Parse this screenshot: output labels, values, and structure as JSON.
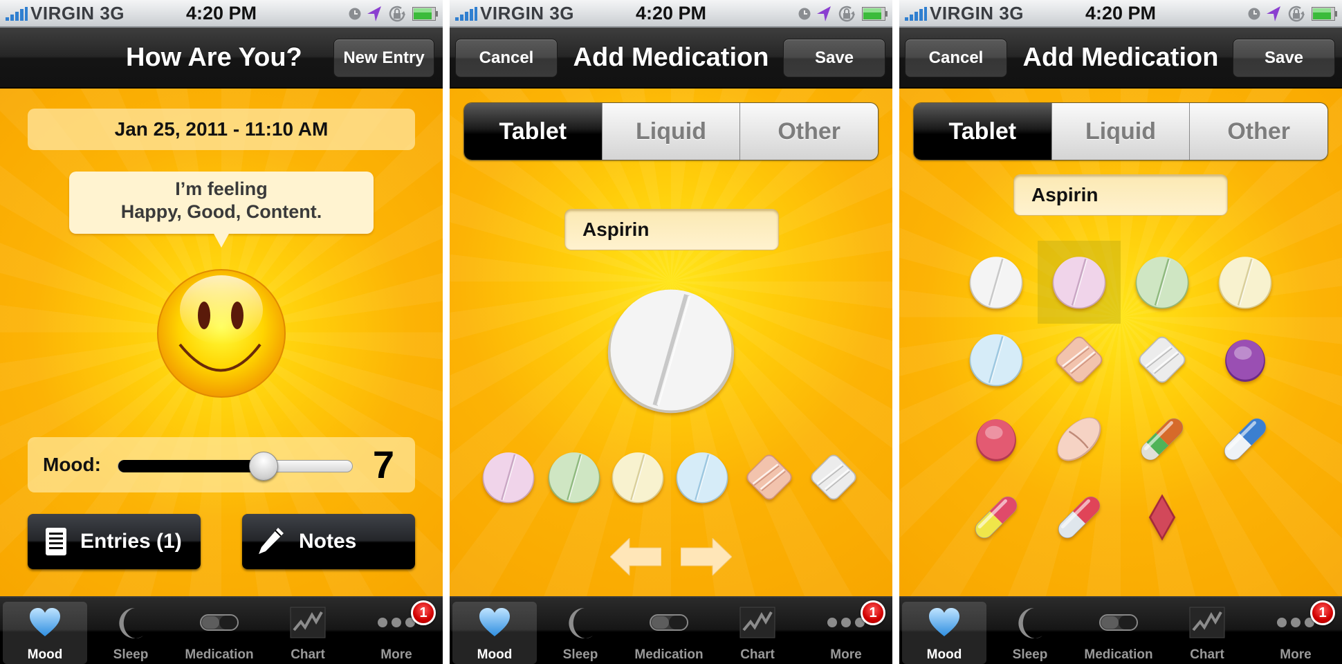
{
  "status_bar": {
    "carrier": "VIRGIN",
    "network": "3G",
    "time": "4:20 PM",
    "icons": [
      "signal-bars-icon",
      "alarm-clock-icon",
      "location-arrow-icon",
      "rotation-lock-icon",
      "battery-icon"
    ]
  },
  "tab_bar": {
    "items": [
      {
        "label": "Mood",
        "icon": "heart-icon",
        "active": true
      },
      {
        "label": "Sleep",
        "icon": "moon-icon",
        "active": false
      },
      {
        "label": "Medication",
        "icon": "capsule-icon",
        "active": false
      },
      {
        "label": "Chart",
        "icon": "line-chart-icon",
        "active": false
      },
      {
        "label": "More",
        "icon": "ellipsis-icon",
        "active": false,
        "badge": "1"
      }
    ]
  },
  "screens": [
    {
      "nav": {
        "title": "How Are You?",
        "right_button": "New Entry"
      },
      "date": "Jan 25, 2011 - 11:10 AM",
      "feeling": {
        "line1": "I’m feeling",
        "line2": "Happy, Good, Content."
      },
      "mood": {
        "label": "Mood:",
        "value": "7",
        "slider_fraction": 0.62
      },
      "buttons": {
        "entries": "Entries (1)",
        "notes": "Notes"
      }
    },
    {
      "nav": {
        "title": "Add Medication",
        "left_button": "Cancel",
        "right_button": "Save"
      },
      "segments": [
        {
          "label": "Tablet",
          "selected": true
        },
        {
          "label": "Liquid",
          "selected": false
        },
        {
          "label": "Other",
          "selected": false
        }
      ],
      "medication_name": "Aspirin",
      "selected_pill": "white-round-scored",
      "pill_row": [
        "pink-round-scored",
        "green-round-scored",
        "yellow-round-scored",
        "blue-round-scored",
        "peach-diamond-scored",
        "white-diamond-scored"
      ],
      "nav_arrows": [
        "previous-arrow",
        "next-arrow"
      ]
    },
    {
      "nav": {
        "title": "Add Medication",
        "left_button": "Cancel",
        "right_button": "Save"
      },
      "segments": [
        {
          "label": "Tablet",
          "selected": true
        },
        {
          "label": "Liquid",
          "selected": false
        },
        {
          "label": "Other",
          "selected": false
        }
      ],
      "medication_name": "Aspirin",
      "pill_grid": [
        "white-round-scored",
        "pink-round-scored",
        "green-round-scored",
        "yellow-round-scored",
        "blue-round-scored",
        "peach-diamond-scored",
        "white-diamond-scored",
        "purple-sphere",
        "red-round",
        "peach-oval-scored",
        "orange-green-capsule",
        "blue-white-capsule",
        "yellow-pink-capsule",
        "white-red-capsule",
        "red-diamond"
      ],
      "highlighted_index": 1
    }
  ],
  "colors": {
    "background_orange": "#fcb305",
    "background_center": "#ffe51a",
    "nav_bar": "#1e1e1e",
    "badge_red": "#d10000",
    "mood_tab_heart": "#5fb2ee"
  }
}
